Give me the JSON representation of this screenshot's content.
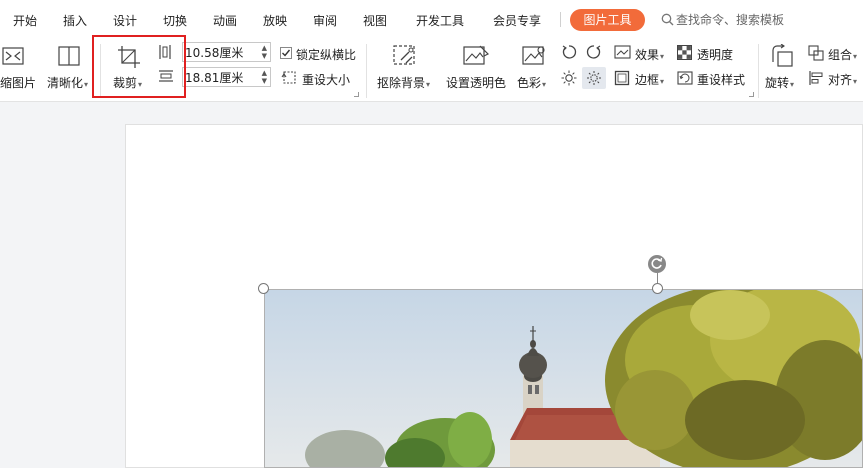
{
  "tabs": [
    {
      "label": "开始"
    },
    {
      "label": "插入"
    },
    {
      "label": "设计"
    },
    {
      "label": "切换"
    },
    {
      "label": "动画"
    },
    {
      "label": "放映"
    },
    {
      "label": "审阅"
    },
    {
      "label": "视图"
    },
    {
      "label": "开发工具"
    },
    {
      "label": "会员专享"
    }
  ],
  "active_tab": "图片工具",
  "search_placeholder": "查找命令、搜索模板",
  "ribbon": {
    "compress": "缩图片",
    "clarity": "清晰化",
    "crop": "裁剪",
    "width_value": "10.58厘米",
    "height_value": "18.81厘米",
    "lock_ratio": "锁定纵横比",
    "reset_size": "重设大小",
    "remove_bg": "抠除背景",
    "set_transparent": "设置透明色",
    "color": "色彩",
    "effects": "效果",
    "transparency": "透明度",
    "border": "边框",
    "reset_style": "重设样式",
    "rotate": "旋转",
    "group": "组合",
    "align": "对齐"
  },
  "colors": {
    "accent": "#f26b3a",
    "highlight_box": "#e02020"
  }
}
